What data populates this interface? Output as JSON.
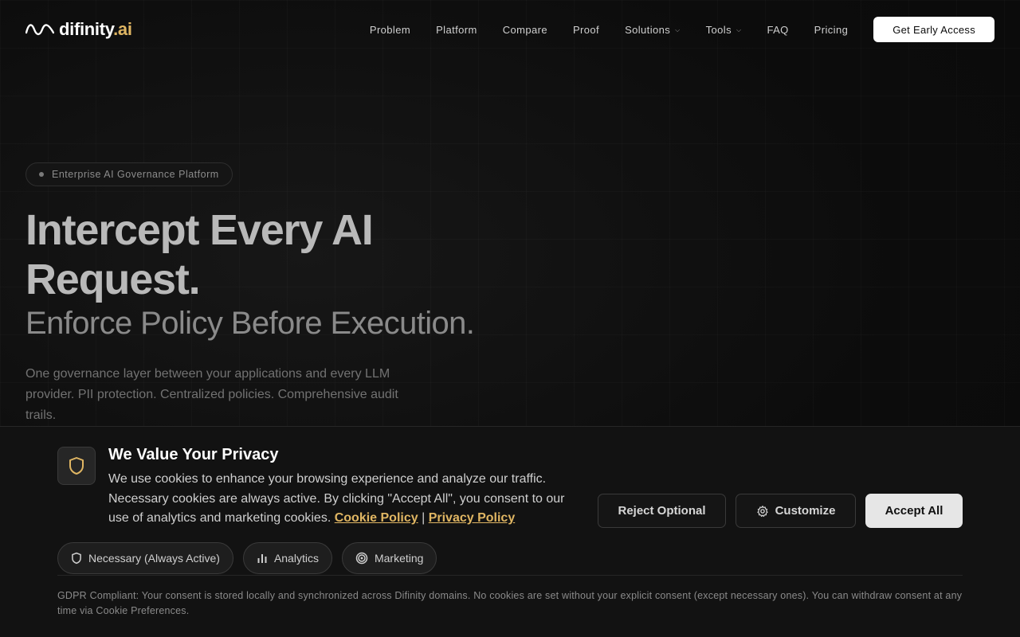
{
  "brand": {
    "name": "difinity",
    "suffix": ".ai",
    "accent": "#e0b663"
  },
  "nav": {
    "links": [
      "Problem",
      "Platform",
      "Compare",
      "Proof",
      "Solutions",
      "Tools",
      "FAQ",
      "Pricing"
    ],
    "cta": "Get Early Access"
  },
  "hero": {
    "badge": "Enterprise AI Governance Platform",
    "title_line1": "Intercept Every AI",
    "title_line2": "Request.",
    "subtitle": "Enforce Policy Before Execution.",
    "description": "One governance layer between your applications and every LLM provider. PII protection. Centralized policies. Comprehensive audit trails."
  },
  "cookie": {
    "title": "We Value Your Privacy",
    "text": "We use cookies to enhance your browsing experience and analyze our traffic. Necessary cookies are always active. By clicking \"Accept All\", you consent to our use of analytics and marketing cookies.",
    "cookie_policy": "Cookie Policy",
    "separator": "|",
    "privacy_policy": "Privacy Policy",
    "buttons": {
      "reject": "Reject Optional",
      "customize": "Customize",
      "accept": "Accept All"
    },
    "chips": {
      "necessary": "Necessary (Always Active)",
      "analytics": "Analytics",
      "marketing": "Marketing"
    },
    "gdpr": "GDPR Compliant: Your consent is stored locally and synchronized across Difinity domains. No cookies are set without your explicit consent (except necessary ones). You can withdraw consent at any time via Cookie Preferences."
  }
}
